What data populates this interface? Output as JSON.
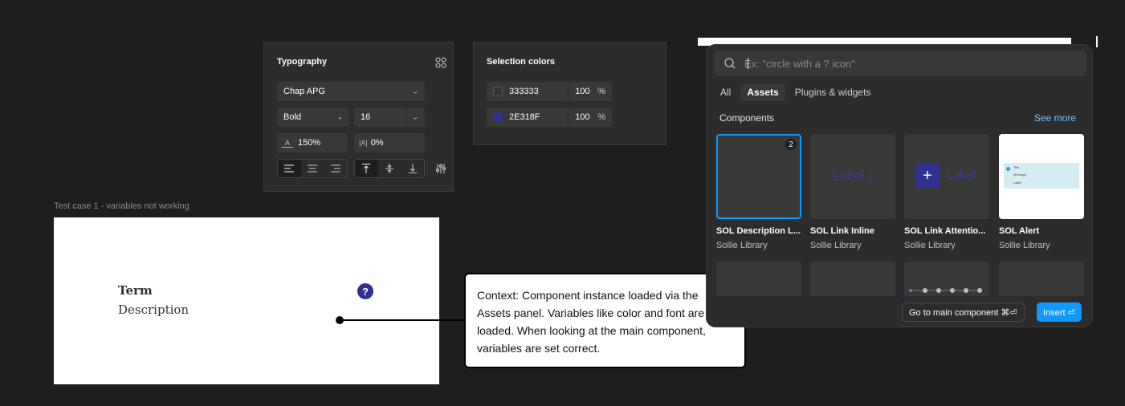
{
  "typography_panel": {
    "title": "Typography",
    "font_family": "Chap APG",
    "font_weight": "Bold",
    "font_size": "16",
    "line_height": "150%",
    "letter_spacing": "0%"
  },
  "selection_colors_panel": {
    "title": "Selection colors",
    "colors": [
      {
        "hex": "333333",
        "opacity": "100",
        "unit": "%",
        "swatch": "#333333"
      },
      {
        "hex": "2E318F",
        "opacity": "100",
        "unit": "%",
        "swatch": "#2E318F"
      }
    ]
  },
  "canvas": {
    "frame_label": "Test case 1 - variables not working",
    "term": "Term",
    "description": "Description",
    "help_icon_glyph": "?"
  },
  "note": {
    "text": "Context: Component instance loaded via the Assets panel. Variables like color and font are not loaded. When looking at the main component, variables are set correct."
  },
  "assets_popup": {
    "search_placeholder": "Ex: \"circle with a ? icon\"",
    "tabs": [
      "All",
      "Assets",
      "Plugins & widgets"
    ],
    "active_tab": "Assets",
    "section_title": "Components",
    "see_more": "See more",
    "components": [
      {
        "name": "SOL Description L...",
        "library": "Sollie Library",
        "badge": "2"
      },
      {
        "name": "SOL Link Inline",
        "library": "Sollie Library"
      },
      {
        "name": "SOL Link Attentio...",
        "library": "Sollie Library"
      },
      {
        "name": "SOL Alert",
        "library": "Sollie Library"
      }
    ],
    "preview_link_label": "Label",
    "alert_preview": {
      "title": "Title",
      "message": "Message",
      "label": "Label"
    },
    "go_to_main": "Go to main component ⌘⏎",
    "insert": "Insert ⏎"
  },
  "colors": {
    "accent_blue": "#0d99ff",
    "brand_indigo": "#2E318F",
    "panel_bg": "#2c2c2c",
    "canvas_bg": "#1e1e1e"
  }
}
